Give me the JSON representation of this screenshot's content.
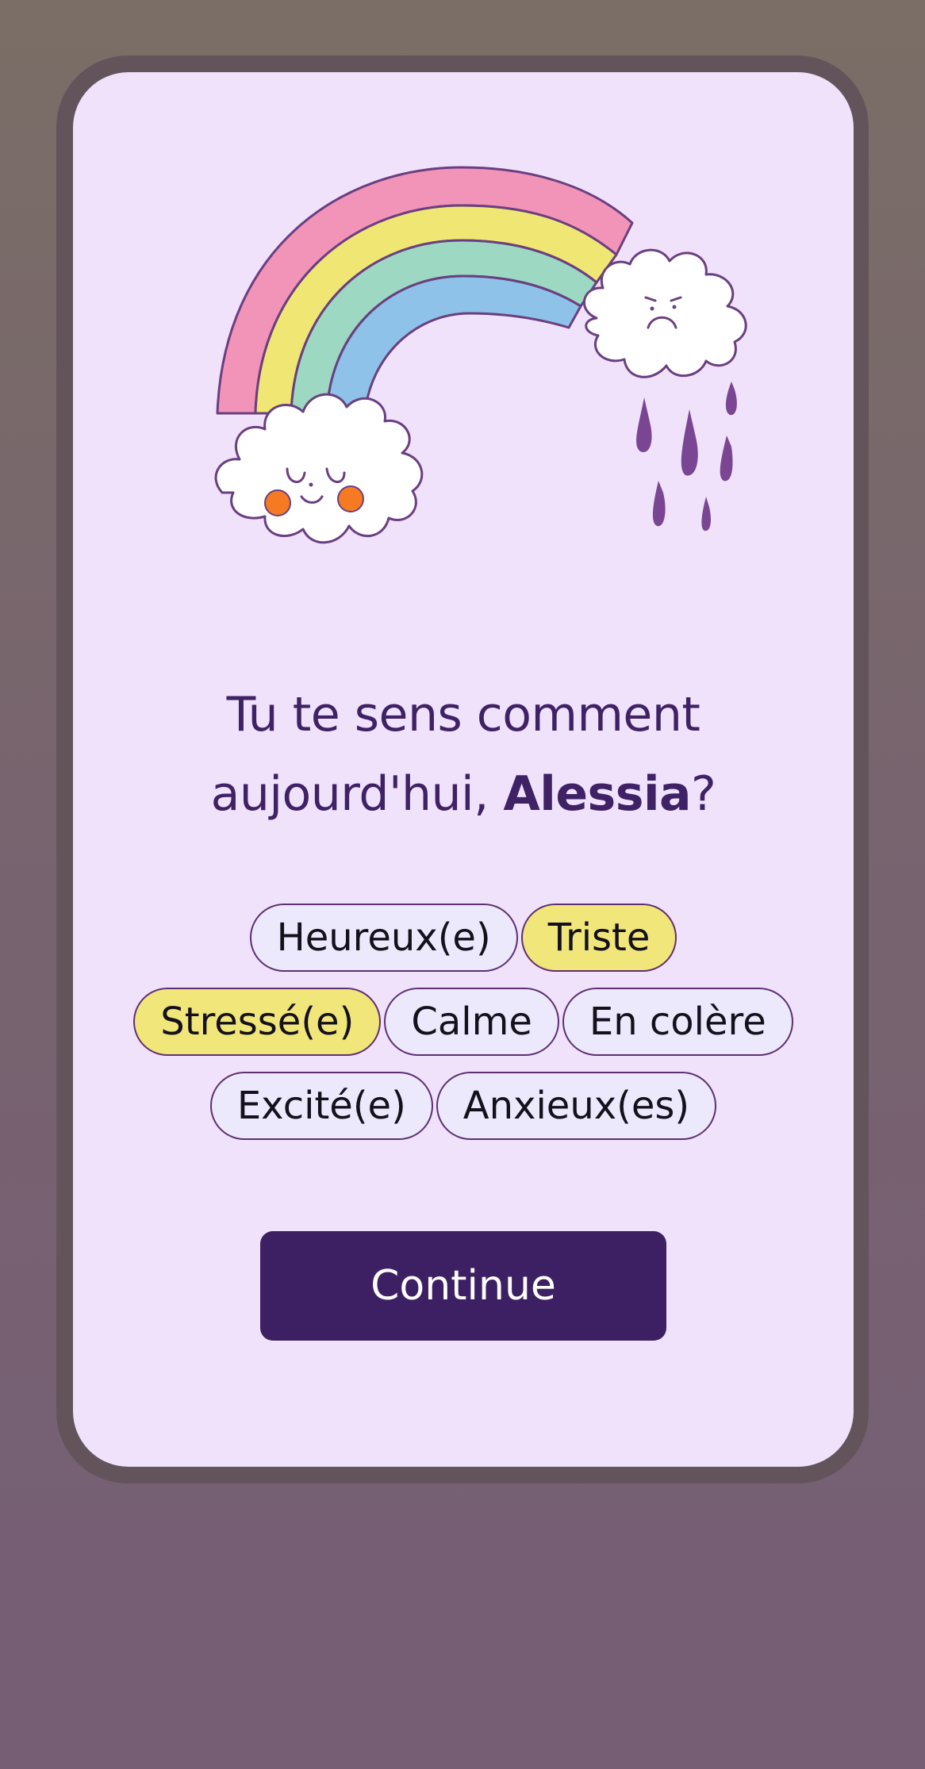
{
  "prompt": {
    "line1": "Tu te sens comment",
    "line2_prefix": "aujourd'hui, ",
    "name": "Alessia",
    "line2_suffix": "?"
  },
  "moods": [
    {
      "label": "Heureux(e)",
      "selected": false
    },
    {
      "label": "Triste",
      "selected": true
    },
    {
      "label": "Stressé(e)",
      "selected": true
    },
    {
      "label": "Calme",
      "selected": false
    },
    {
      "label": "En colère",
      "selected": false
    },
    {
      "label": "Excité(e)",
      "selected": false
    },
    {
      "label": "Anxieux(es)",
      "selected": false
    }
  ],
  "continue_label": "Continue",
  "illustration": {
    "icon": "rainbow-with-happy-and-sad-clouds-icon",
    "colors": {
      "pink": "#f194b8",
      "yellow": "#f0e673",
      "green": "#9dd8c2",
      "blue": "#8ec2e8",
      "outline": "#6a3f80",
      "cheeks": "#f67a22",
      "rain": "#7a4694"
    }
  },
  "colors": {
    "modal_background": "#f0e2fb",
    "text": "#3f2166",
    "chip_default": "#ebe9fb",
    "chip_selected": "#f1e679",
    "button": "#3d1f63"
  }
}
